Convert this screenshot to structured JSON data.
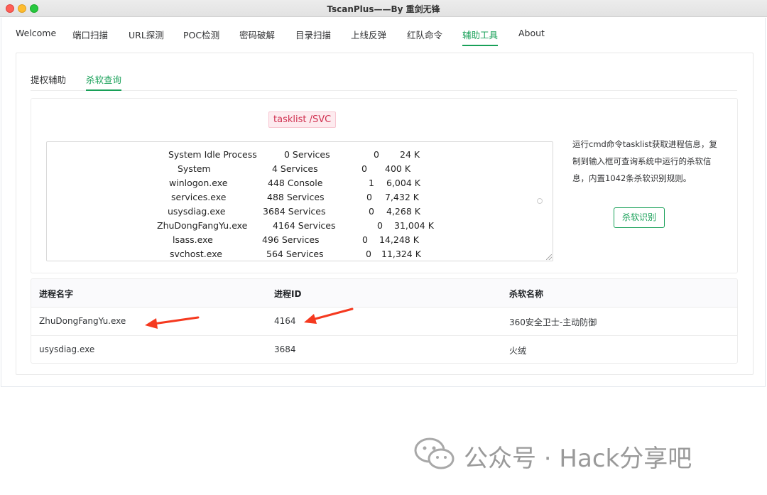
{
  "window": {
    "title": "TscanPlus——By 重剑无锋"
  },
  "main_tabs": [
    {
      "label": "Welcome"
    },
    {
      "label": "端口扫描"
    },
    {
      "label": "URL探测"
    },
    {
      "label": "POC检测"
    },
    {
      "label": "密码破解"
    },
    {
      "label": "目录扫描"
    },
    {
      "label": "上线反弹"
    },
    {
      "label": "红队命令"
    },
    {
      "label": "辅助工具",
      "active": true
    },
    {
      "label": "About"
    }
  ],
  "sub_tabs": [
    {
      "label": "提权辅助"
    },
    {
      "label": "杀软查询",
      "active": true
    }
  ],
  "command_tag": "tasklist /SVC",
  "tasklist_rows": [
    {
      "name": "System Idle Process",
      "pid_svc": "0 Services",
      "session": "0",
      "mem": "24 K"
    },
    {
      "name": "System",
      "pid_svc": "4 Services",
      "session": "0",
      "mem": "400 K"
    },
    {
      "name": "winlogon.exe",
      "pid_svc": "448 Console",
      "session": "1",
      "mem": "6,004 K"
    },
    {
      "name": "services.exe",
      "pid_svc": "488 Services",
      "session": "0",
      "mem": "7,432 K"
    },
    {
      "name": "usysdiag.exe",
      "pid_svc": "3684 Services",
      "session": "0",
      "mem": "4,268  K"
    },
    {
      "name": "ZhuDongFangYu.exe",
      "pid_svc": "4164 Services",
      "session": "0",
      "mem": "31,004 K"
    },
    {
      "name": "lsass.exe",
      "pid_svc": "496 Services",
      "session": "0",
      "mem": "14,248 K"
    },
    {
      "name": "svchost.exe",
      "pid_svc": "564 Services",
      "session": "0",
      "mem": "11,324 K"
    }
  ],
  "description": "运行cmd命令tasklist获取进程信息，复制到输入框可查询系统中运行的杀软信息，内置1042条杀软识别规则。",
  "detect_button": "杀软识别",
  "table": {
    "headers": [
      "进程名字",
      "进程ID",
      "杀软名称"
    ],
    "rows": [
      {
        "process": "ZhuDongFangYu.exe",
        "pid": "4164",
        "av": "360安全卫士-主动防御"
      },
      {
        "process": "usysdiag.exe",
        "pid": "3684",
        "av": "火绒"
      }
    ]
  },
  "watermark": {
    "text": "公众号 · Hack分享吧",
    "icon": "wechat-icon"
  },
  "colors": {
    "accent": "#18a058",
    "tag_red": "#d03050",
    "arrow": "#f5391f"
  }
}
